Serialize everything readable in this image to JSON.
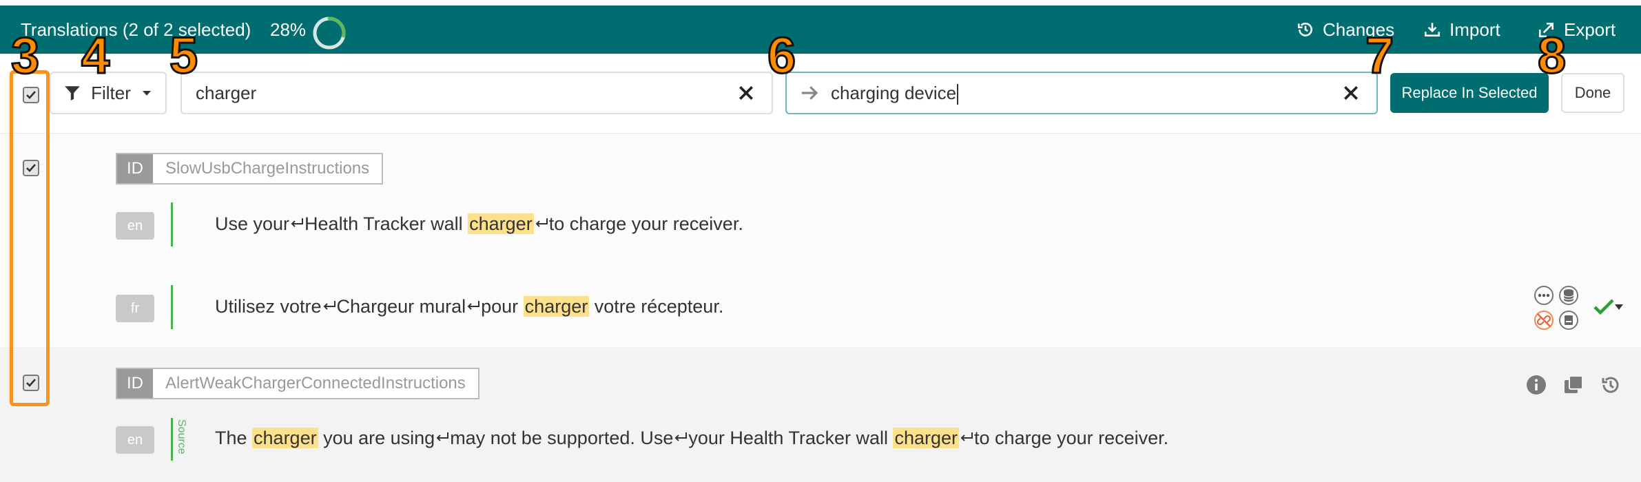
{
  "header": {
    "title": "Translations (2 of 2 selected)",
    "progress_text": "28%",
    "progress_value": 0.28,
    "actions": {
      "changes": "Changes",
      "import": "Import",
      "export": "Export"
    }
  },
  "toolbar": {
    "filter_label": "Filter",
    "find_value": "charger",
    "replace_value": "charging device",
    "replace_button": "Replace In Selected",
    "done_button": "Done"
  },
  "rows": [
    {
      "id_key": "ID",
      "id_value": "SlowUsbChargeInstructions",
      "source": {
        "lang": "en",
        "segments": [
          "Use your",
          "Health Tracker wall ",
          "charger",
          "",
          "to charge your receiver."
        ]
      },
      "target": {
        "lang": "fr",
        "segments": [
          "Utilisez votre",
          "Chargeur mural",
          "pour ",
          "charger",
          " votre récepteur."
        ]
      }
    },
    {
      "id_key": "ID",
      "id_value": "AlertWeakChargerConnectedInstructions",
      "source_label": "Source",
      "source": {
        "lang": "en",
        "segments": [
          "The ",
          "charger",
          " you are using",
          "may not be supported. Use",
          "your Health Tracker wall ",
          "charger",
          "",
          "to charge your receiver."
        ]
      }
    }
  ],
  "annotations": [
    "3",
    "4",
    "5",
    "6",
    "7",
    "8"
  ],
  "colors": {
    "brand": "#006d70",
    "highlight": "#fde08a",
    "annotation": "#ff8c00",
    "ok": "#2e9e3a"
  }
}
